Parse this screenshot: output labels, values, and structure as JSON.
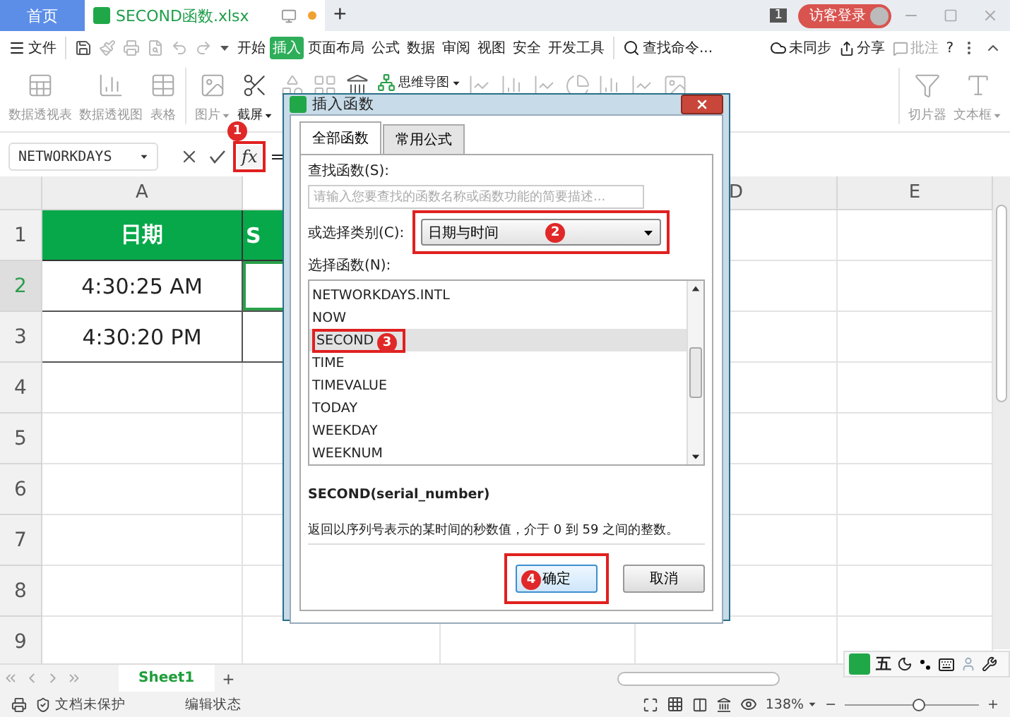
{
  "title_bar": {
    "home_tab": "首页",
    "document": {
      "title": "SECOND函数.xlsx",
      "unsaved": true
    },
    "new_tab": "+",
    "window_count": "1",
    "login": "访客登录"
  },
  "menu": {
    "file": "文件",
    "tabs": [
      {
        "label": "开始",
        "selected": false
      },
      {
        "label": "插入",
        "selected": true
      },
      {
        "label": "页面布局",
        "selected": false
      },
      {
        "label": "公式",
        "selected": false
      },
      {
        "label": "数据",
        "selected": false
      },
      {
        "label": "审阅",
        "selected": false
      },
      {
        "label": "视图",
        "selected": false
      },
      {
        "label": "安全",
        "selected": false
      },
      {
        "label": "开发工具",
        "selected": false
      }
    ],
    "search": "查找命令...",
    "sync": "未同步",
    "share": "分享",
    "comment": "批注",
    "help": "?"
  },
  "ribbon": [
    {
      "kind": "large",
      "label": "数据透视表",
      "disabled": true
    },
    {
      "kind": "large",
      "label": "数据透视图",
      "disabled": true
    },
    {
      "kind": "large",
      "label": "表格",
      "disabled": true
    },
    {
      "kind": "separator"
    },
    {
      "kind": "large",
      "label": "图片",
      "disabled": true,
      "menu": true
    },
    {
      "kind": "large",
      "label": "截屏",
      "disabled": false,
      "menu": true
    },
    {
      "kind": "icon",
      "disabled": true
    },
    {
      "kind": "icon",
      "disabled": true
    },
    {
      "kind": "icon",
      "disabled": false
    },
    {
      "kind": "small",
      "label": "思维导图",
      "disabled": false,
      "menu": true
    },
    {
      "kind": "icon",
      "disabled": true
    },
    {
      "kind": "icon",
      "disabled": true
    },
    {
      "kind": "icon",
      "disabled": true
    },
    {
      "kind": "icon",
      "disabled": true
    },
    {
      "kind": "icon",
      "disabled": true
    },
    {
      "kind": "icon",
      "disabled": true
    },
    {
      "kind": "icon",
      "disabled": true
    },
    {
      "kind": "separator"
    },
    {
      "kind": "large",
      "label": "切片器",
      "disabled": true
    },
    {
      "kind": "large",
      "label": "文本框",
      "disabled": true,
      "menu": true
    }
  ],
  "formula_bar": {
    "name_box": "NETWORKDAYS",
    "fx": "fx",
    "fx_badge": "1",
    "formula": "="
  },
  "sheet": {
    "columns": [
      {
        "label": "A"
      },
      {
        "label": "D"
      },
      {
        "label": "E"
      }
    ],
    "rows": [
      {
        "number": "1",
        "kind": "header",
        "selected": false,
        "cells": [
          {
            "text": "日期",
            "selected": false
          },
          {
            "text": "S",
            "selected": false
          }
        ]
      },
      {
        "number": "2",
        "kind": "data",
        "selected": true,
        "cells": [
          {
            "text": "4:30:25 AM",
            "selected": false
          },
          {
            "selected": true
          }
        ]
      },
      {
        "number": "3",
        "kind": "data",
        "selected": false,
        "cells": [
          {
            "text": "4:30:20 PM",
            "selected": false
          },
          {
            "selected": false
          }
        ]
      },
      {
        "number": "4",
        "kind": "empty",
        "selected": false
      },
      {
        "number": "5",
        "kind": "empty",
        "selected": false
      },
      {
        "number": "6",
        "kind": "empty",
        "selected": false
      },
      {
        "number": "7",
        "kind": "empty",
        "selected": false
      },
      {
        "number": "8",
        "kind": "empty",
        "selected": false
      },
      {
        "number": "9",
        "kind": "empty",
        "selected": false
      }
    ]
  },
  "sheet_tabs": {
    "sheets": [
      {
        "label": "Sheet1",
        "selected": true
      }
    ],
    "add": "+"
  },
  "ime_toolbar": {
    "mode": "五"
  },
  "status_bar": {
    "protection": "文档未保护",
    "mode": "编辑状态",
    "zoom": "138%",
    "zoom_slider": {
      "level": 0.55
    },
    "zoom_out": "−",
    "zoom_in": "+"
  },
  "dialog": {
    "title": "插入函数",
    "tabs": [
      {
        "label": "全部函数",
        "selected": true
      },
      {
        "label": "常用公式",
        "selected": false
      }
    ],
    "search_label": "查找函数(S):",
    "search_placeholder": "请输入您要查找的函数名称或函数功能的简要描述...",
    "category_label": "或选择类别(C):",
    "category": "日期与时间",
    "category_badge": "2",
    "list_label": "选择函数(N):",
    "functions": [
      {
        "name": "NETWORKDAYS.INTL",
        "selected": false
      },
      {
        "name": "NOW",
        "selected": false
      },
      {
        "name": "SECOND",
        "selected": true,
        "badge": "3"
      },
      {
        "name": "TIME",
        "selected": false
      },
      {
        "name": "TIMEVALUE",
        "selected": false
      },
      {
        "name": "TODAY",
        "selected": false
      },
      {
        "name": "WEEKDAY",
        "selected": false
      },
      {
        "name": "WEEKNUM",
        "selected": false
      }
    ],
    "signature": "SECOND(serial_number)",
    "description": "返回以序列号表示的某时间的秒数值，介于 0 到 59 之间的整数。",
    "buttons": [
      {
        "label": "确定",
        "kind": "primary",
        "badge": "4"
      },
      {
        "label": "取消",
        "kind": "secondary"
      }
    ]
  }
}
